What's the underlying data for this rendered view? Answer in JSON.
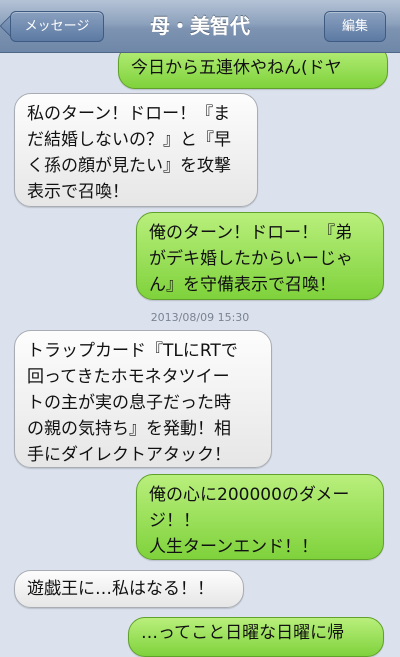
{
  "navbar": {
    "back_label": "メッセージ",
    "title": "母・美智代",
    "edit_label": "編集"
  },
  "messages": [
    {
      "side": "sent",
      "text": "今日から五連休やねん(ドヤ"
    },
    {
      "side": "received",
      "text": "私のターン！ドロー！『ま\nだ結婚しないの？』と『早\nく孫の顔が見たい』を攻撃\n表示で召喚！"
    },
    {
      "side": "sent",
      "text": "俺のターン！ドロー！『弟\nがデキ婚したからいーじゃ\nん』を守備表示で召喚！"
    },
    {
      "side": "received",
      "text": "トラップカード『TLにRTで\n回ってきたホモネタツイー\nトの主が実の息子だった時\nの親の気持ち』を発動！相\n手にダイレクトアタック！"
    },
    {
      "side": "sent",
      "text": "俺の心に200000のダメー\nジ！！\n人生ターンエンド！！"
    },
    {
      "side": "received",
      "text": "遊戯王に…私はなる！！"
    },
    {
      "side": "sent",
      "text": "…ってこと日曜な日曜に帰"
    }
  ],
  "timestamp": "2013/08/09 15:30",
  "colors": {
    "background": "#dbe2ed",
    "sent_bubble": "#8fd94a",
    "received_bubble": "#f2f2f2",
    "navbar": "#8da2bd"
  }
}
